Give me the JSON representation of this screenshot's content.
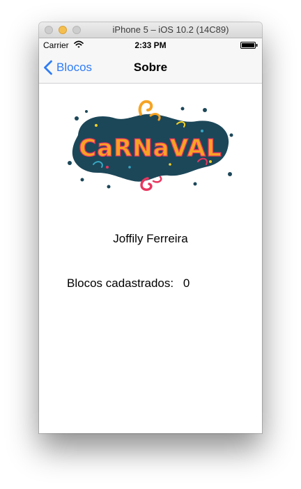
{
  "simulator": {
    "title": "iPhone 5 – iOS 10.2 (14C89)"
  },
  "status_bar": {
    "carrier": "Carrier",
    "time": "2:33 PM"
  },
  "nav_bar": {
    "back_label": "Blocos",
    "title": "Sobre"
  },
  "content": {
    "logo_text": "CaRNaVAL",
    "author_name": "Joffily Ferreira",
    "count_label": "Blocos cadastrados:",
    "count_value": "0"
  },
  "colors": {
    "accent": "#2f7cf6",
    "logo_blob": "#1c4759",
    "logo_orange": "#f6a323",
    "logo_pink": "#e9365f",
    "logo_yellow": "#f4d125",
    "logo_teal": "#37a8c4"
  },
  "icons": {
    "back": "chevron-left-icon",
    "wifi": "wifi-icon",
    "battery": "battery-icon"
  }
}
